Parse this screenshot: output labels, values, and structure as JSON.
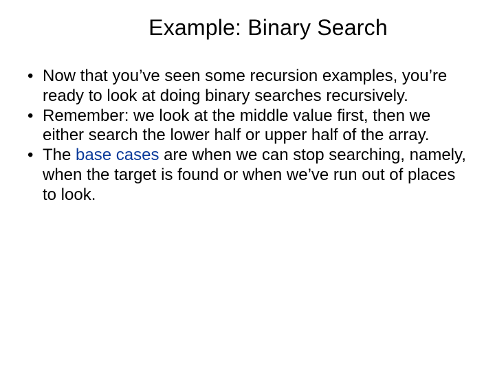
{
  "slide": {
    "title": "Example: Binary Search",
    "bullets": [
      {
        "pre": "Now that you’ve seen some recursion examples, you’re ready to look at doing binary searches recursively."
      },
      {
        "pre": "Remember: we look at the middle value first, then we either search the lower half or upper half of the array."
      },
      {
        "pre": "The ",
        "em": "base cases",
        "post": " are when we can stop searching, namely, when the target is found or when we’ve run out of places to look."
      }
    ]
  }
}
